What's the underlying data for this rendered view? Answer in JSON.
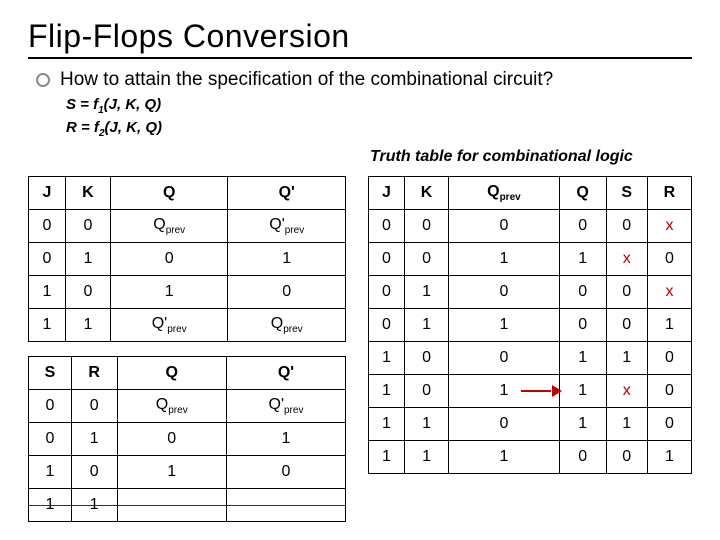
{
  "title": "Flip-Flops Conversion",
  "question": "How to attain the specification of the combinational circuit?",
  "eq1_html": "S = f<span class='sub'>1</span>(J, K, Q)",
  "eq2_html": "R = f<span class='sub'>2</span>(J, K, Q)",
  "truth_caption": "Truth table for combinational logic",
  "jk_table": {
    "headers": [
      "J",
      "K",
      "Q",
      "Q'"
    ],
    "rows": [
      [
        "0",
        "0",
        "Q<span class='sub'>prev</span>",
        "Q'<span class='sub'>prev</span>"
      ],
      [
        "0",
        "1",
        "0",
        "1"
      ],
      [
        "1",
        "0",
        "1",
        "0"
      ],
      [
        "1",
        "1",
        "Q'<span class='sub'>prev</span>",
        "Q<span class='sub'>prev</span>"
      ]
    ]
  },
  "sr_table": {
    "headers": [
      "S",
      "R",
      "Q",
      "Q'"
    ],
    "rows": [
      [
        "0",
        "0",
        "Q<span class='sub'>prev</span>",
        "Q'<span class='sub'>prev</span>"
      ],
      [
        "0",
        "1",
        "0",
        "1"
      ],
      [
        "1",
        "0",
        "1",
        "0"
      ],
      [
        "1",
        "1",
        "",
        ""
      ]
    ],
    "strike_row_index": 3
  },
  "comb_table": {
    "headers": [
      "J",
      "K",
      "Q<span class='sub'>prev</span>",
      "Q",
      "S",
      "R"
    ],
    "rows": [
      [
        "0",
        "0",
        "0",
        "0",
        "0",
        "<span class='redx'>x</span>"
      ],
      [
        "0",
        "0",
        "1",
        "1",
        "<span class='redx'>x</span>",
        "0"
      ],
      [
        "0",
        "1",
        "0",
        "0",
        "0",
        "<span class='redx'>x</span>"
      ],
      [
        "0",
        "1",
        "1",
        "0",
        "0",
        "1"
      ],
      [
        "1",
        "0",
        "0",
        "1",
        "1",
        "0"
      ],
      [
        "1",
        "0",
        "1",
        "1",
        "<span class='redx'>x</span>",
        "0"
      ],
      [
        "1",
        "1",
        "0",
        "1",
        "1",
        "0"
      ],
      [
        "1",
        "1",
        "1",
        "0",
        "0",
        "1"
      ]
    ],
    "arrow_row_index": 5,
    "arrow_col_index": 2
  }
}
